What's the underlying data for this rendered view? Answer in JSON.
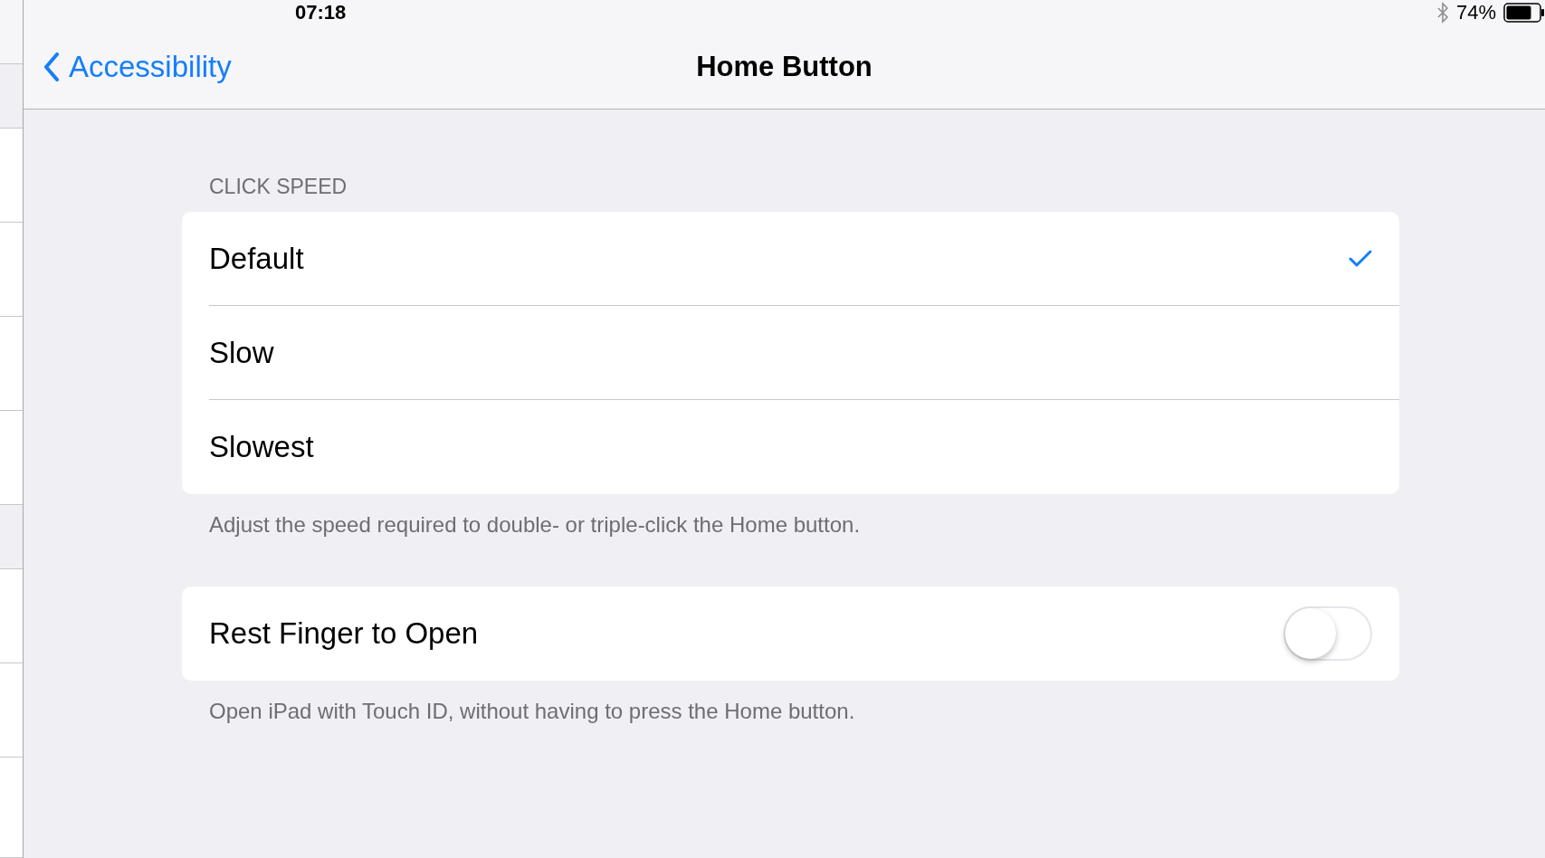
{
  "status_bar": {
    "time": "07:18",
    "battery": "74%"
  },
  "nav": {
    "back": "Accessibility",
    "title": "Home Button"
  },
  "sections": [
    {
      "kind": "choices",
      "header": "CLICK SPEED",
      "items": [
        {
          "label": "Default",
          "selected": true
        },
        {
          "label": "Slow",
          "selected": false
        },
        {
          "label": "Slowest",
          "selected": false
        }
      ],
      "footer": "Adjust the speed required to double- or triple-click the Home button."
    },
    {
      "kind": "toggles",
      "items": [
        {
          "label": "Rest Finger to Open",
          "on": false
        }
      ],
      "footer": "Open iPad with Touch ID, without having to press the Home button."
    }
  ]
}
